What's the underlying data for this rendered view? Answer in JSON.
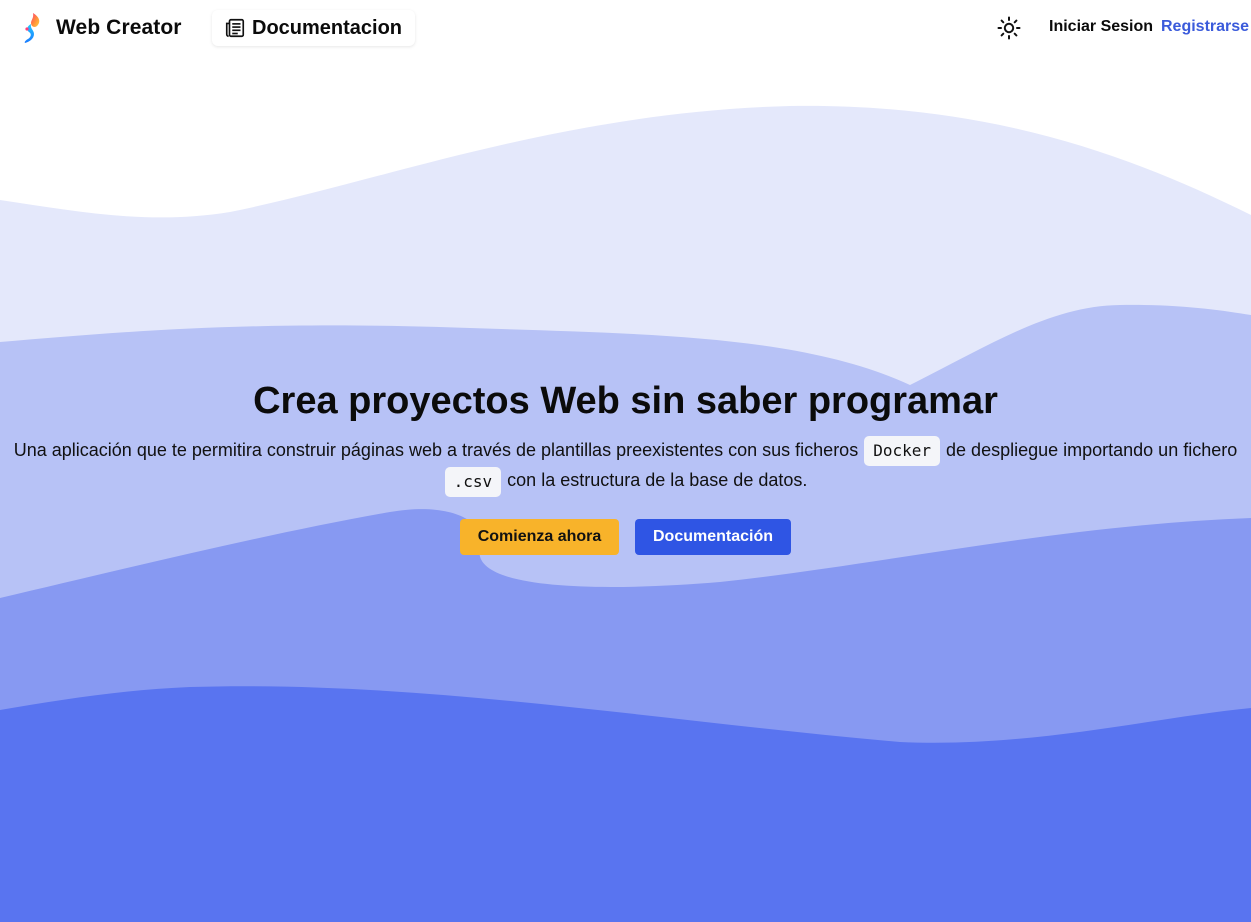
{
  "colors": {
    "wave_1": "#e4e8fb",
    "wave_2": "#b7c2f6",
    "wave_3": "#8799f2",
    "wave_4": "#5974f0",
    "accent_yellow": "#f8b32a",
    "accent_blue": "#2f55e4",
    "link_blue": "#3b5bdb"
  },
  "navbar": {
    "brand": "Web Creator",
    "brand_icon": "flame-logo-icon",
    "docs_label": "Documentacion",
    "docs_icon": "newspaper-icon",
    "theme_icon": "sun-icon",
    "login_label": "Iniciar Sesion",
    "register_label": "Registrarse"
  },
  "hero": {
    "title": "Crea proyectos Web sin saber programar",
    "desc_part1": "Una aplicación que te permitira construir páginas web a través de plantillas preexistentes con sus ficheros",
    "code_1": "Docker",
    "desc_part2": "de despliegue importando un fichero",
    "code_2": ".csv",
    "desc_part3": "con la estructura de la base de datos.",
    "primary_button": "Comienza ahora",
    "secondary_button": "Documentación"
  }
}
